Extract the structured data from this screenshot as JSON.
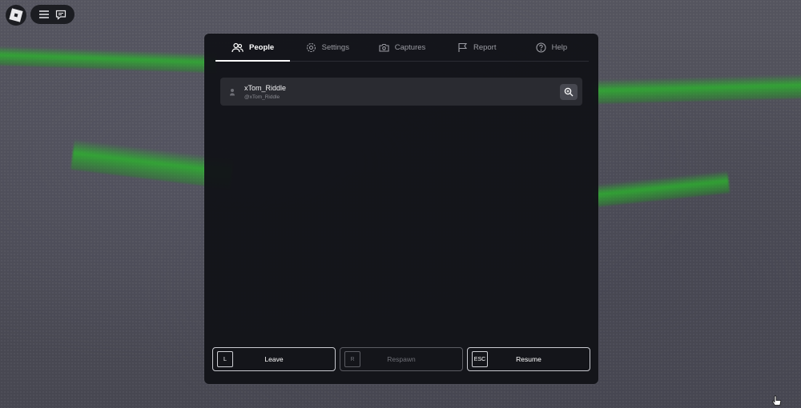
{
  "top_controls": {
    "logo_icon": "roblox-logo-icon",
    "menu_icon": "hamburger-icon",
    "chat_icon": "chat-icon"
  },
  "tabs": [
    {
      "id": "people",
      "label": "People",
      "icon": "people-icon",
      "active": true
    },
    {
      "id": "settings",
      "label": "Settings",
      "icon": "gear-icon",
      "active": false
    },
    {
      "id": "captures",
      "label": "Captures",
      "icon": "camera-icon",
      "active": false
    },
    {
      "id": "report",
      "label": "Report",
      "icon": "flag-icon",
      "active": false
    },
    {
      "id": "help",
      "label": "Help",
      "icon": "help-icon",
      "active": false
    }
  ],
  "players": [
    {
      "display_name": "xTom_Riddle",
      "username": "@xTom_Riddle",
      "rank_icon": "player-icon",
      "action_icon": "inspect-icon"
    }
  ],
  "actions": [
    {
      "key": "L",
      "label": "Leave",
      "enabled": true
    },
    {
      "key": "R",
      "label": "Respawn",
      "enabled": false
    },
    {
      "key": "ESC",
      "label": "Resume",
      "enabled": true
    }
  ],
  "colors": {
    "panel_bg": "#121318",
    "active_tab": "#ffffff",
    "inactive_tab": "#9b9ca3",
    "scene_green": "#28be28"
  }
}
